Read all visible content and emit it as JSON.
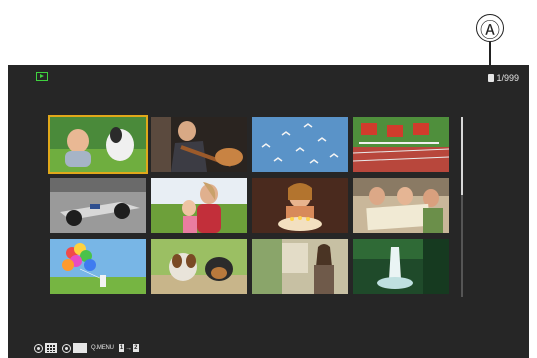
{
  "callout": {
    "label": "Ⓐ"
  },
  "header": {
    "counter": "1/999"
  },
  "grid": {
    "thumbnails": [
      {
        "subject": "boy-with-dog",
        "selected": true
      },
      {
        "subject": "violinist",
        "selected": false
      },
      {
        "subject": "birds-in-sky",
        "selected": false
      },
      {
        "subject": "hurdle-race",
        "selected": false
      },
      {
        "subject": "race-car",
        "selected": false
      },
      {
        "subject": "mother-child-field",
        "selected": false
      },
      {
        "subject": "birthday-girl-candles",
        "selected": false
      },
      {
        "subject": "family-with-map",
        "selected": false
      },
      {
        "subject": "child-with-balloons",
        "selected": false
      },
      {
        "subject": "dogs-on-path",
        "selected": false
      },
      {
        "subject": "woman-in-town",
        "selected": false
      },
      {
        "subject": "waterfall",
        "selected": false
      }
    ]
  },
  "footer": {
    "qmenu": "Q.MENU",
    "zoom_from": "1",
    "zoom_to": "2",
    "zoom_sep": "→"
  },
  "colors": {
    "screen": "#262626",
    "selection": "#e0a81a",
    "play_icon": "#3fd23f"
  }
}
